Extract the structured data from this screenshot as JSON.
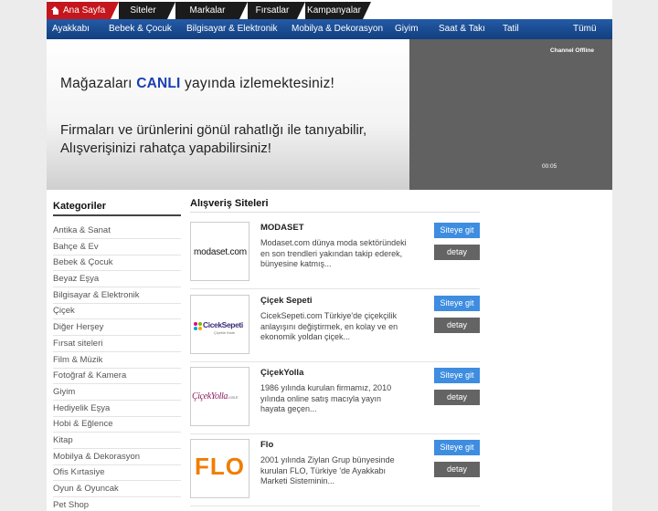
{
  "top_tabs": [
    "Ana Sayfa",
    "Siteler",
    "Markalar",
    "Fırsatlar",
    "Kampanyalar"
  ],
  "nav": [
    "Ayakkabı",
    "Bebek & Çocuk",
    "Bilgisayar & Elektronik",
    "Mobilya & Dekorasyon",
    "Giyim",
    "Saat & Takı",
    "Tatil",
    "Tümü"
  ],
  "banner": {
    "line1_pre": "Mağazaları ",
    "line1_highlight": "CANLI",
    "line1_post": " yayında izlemektesiniz!",
    "line2": "Firmaları ve ürünlerini gönül rahatlığı ile tanıyabilir,",
    "line3": "Alışverişinizi rahatça yapabilirsiniz!"
  },
  "video": {
    "status": "Channel Offline",
    "time": "00:05"
  },
  "sidebar": {
    "title": "Kategoriler",
    "items": [
      "Antika & Sanat",
      "Bahçe & Ev",
      "Bebek & Çocuk",
      "Beyaz Eşya",
      "Bilgisayar & Elektronik",
      "Çiçek",
      "Diğer Herşey",
      "Fırsat siteleri",
      "Film & Müzik",
      "Fotoğraf & Kamera",
      "Giyim",
      "Hediyelik Eşya",
      "Hobi & Eğlence",
      "Kitap",
      "Mobilya & Dekorasyon",
      "Ofis Kırtasiye",
      "Oyun & Oyuncak",
      "Pet Shop"
    ]
  },
  "main": {
    "title": "Alışveriş Siteleri",
    "go_label": "Siteye git",
    "detail_label": "detay",
    "sites": [
      {
        "name": "MODASET",
        "desc": "Modaset.com dünya moda sektöründeki en son trendleri yakından takip ederek, bünyesine katmış...",
        "logo_text": "modaset.com"
      },
      {
        "name": "Çiçek Sepeti",
        "desc": "CicekSepeti.com Türkiye'de çiçekçilik anlayışını değiştirmek, en kolay ve en ekonomik yoldan çiçek...",
        "logo_text": "CicekSepeti",
        "logo_sub": "Çiçekle Ifade"
      },
      {
        "name": "ÇiçekYolla",
        "desc": "1986 yılında kurulan firmamız, 2010 yılında online satış macıyla yayın hayata geçen...",
        "logo_text": "ÇiçekYolla",
        "logo_sub": ".com.tr"
      },
      {
        "name": "Flo",
        "desc": "2001 yılında Ziylan Grup bünyesinde kurulan FLO, Türkiye 'de Ayakkabı Marketi Sisteminin...",
        "logo_text": "FLO"
      }
    ]
  },
  "colors": {
    "home_tab": "#c5161d",
    "nav_bar": "#1d4f96",
    "highlight": "#1a3fb3",
    "go_button": "#3e8de0",
    "detail_button": "#646464",
    "flo_orange": "#f07d00"
  }
}
